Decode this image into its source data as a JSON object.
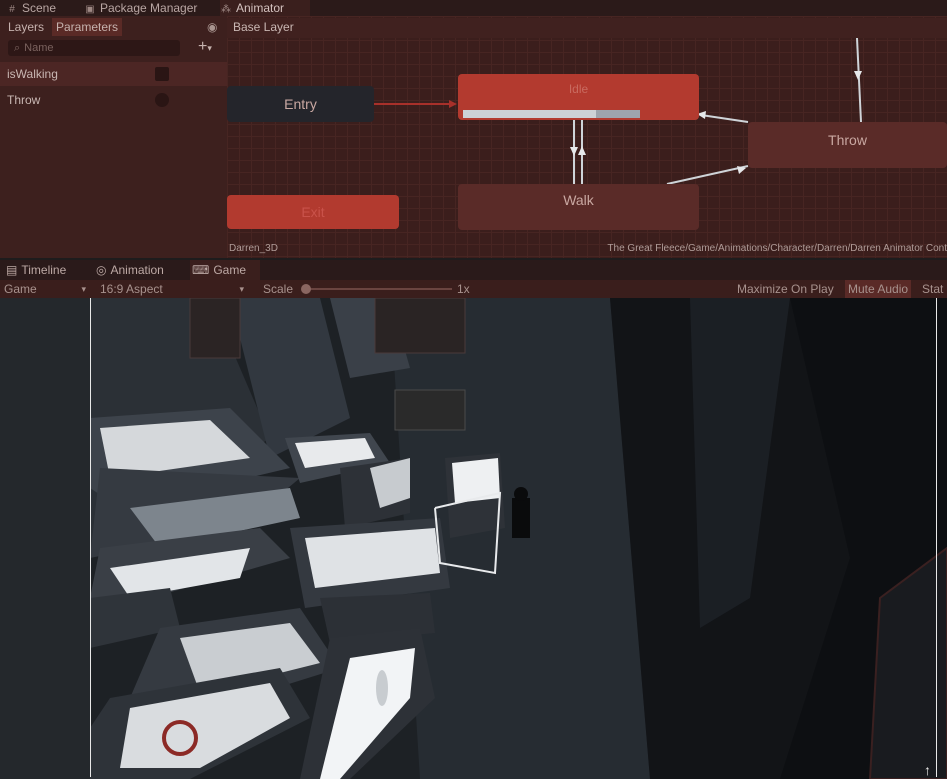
{
  "top_tabs": [
    {
      "label": "Scene",
      "icon": "grid-icon"
    },
    {
      "label": "Package Manager",
      "icon": "package-icon"
    },
    {
      "label": "Animator",
      "icon": "animator-icon",
      "active": true
    }
  ],
  "animator": {
    "left_tabs": [
      "Layers",
      "Parameters"
    ],
    "search_placeholder": "Name",
    "add_label": "+",
    "parameters": [
      {
        "name": "isWalking",
        "type": "bool"
      },
      {
        "name": "Throw",
        "type": "trigger"
      }
    ],
    "layer": "Base Layer",
    "nodes": {
      "entry": "Entry",
      "idle": "Idle",
      "walk": "Walk",
      "throw": "Throw",
      "exit": "Exit"
    },
    "idle_progress": 0.75,
    "footer_left": "Darren_3D",
    "footer_right": "The Great Fleece/Game/Animations/Character/Darren/Darren Animator Cont"
  },
  "bottom_tabs": [
    {
      "label": "Timeline",
      "icon": "timeline-icon"
    },
    {
      "label": "Animation",
      "icon": "animation-icon"
    },
    {
      "label": "Game",
      "icon": "gamepad-icon",
      "active": true
    }
  ],
  "game_toolbar": {
    "display": "Game",
    "aspect": "16:9 Aspect",
    "scale_label": "Scale",
    "scale_value": "1x",
    "maximize": "Maximize On Play",
    "mute": "Mute Audio",
    "stats": "Stat"
  },
  "colors": {
    "accent": "#b33a2f",
    "panel": "#3a1e1c",
    "tint": "#5a2b28"
  }
}
